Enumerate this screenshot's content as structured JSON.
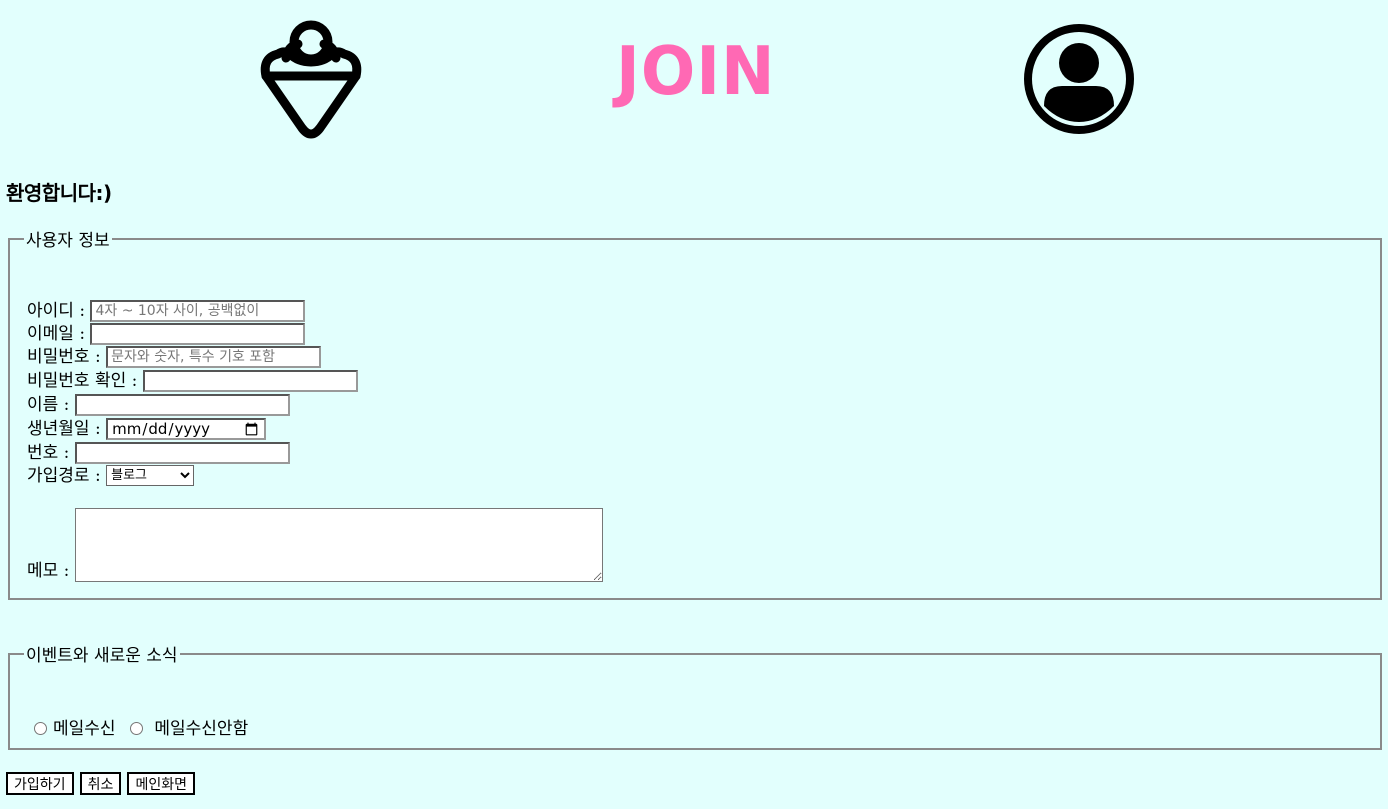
{
  "header": {
    "title": "JOIN",
    "logo_icon": "ice-cream-icon",
    "profile_icon": "user-circle-icon",
    "title_color": "#ff69b4"
  },
  "welcome": "환영합니다:)",
  "user_info": {
    "legend": "사용자 정보",
    "id_label": "아이디 :",
    "id_placeholder": "4자 ~ 10자 사이, 공백없이",
    "email_label": "이메일 :",
    "password_label": "비밀번호 :",
    "password_placeholder": "문자와 숫자, 특수 기호 포함",
    "password_confirm_label": "비밀번호 확인 :",
    "name_label": "이름 :",
    "birthday_label": "생년월일 :",
    "birthday_value": "mm/dd/yyyy",
    "phone_label": "번호 :",
    "signup_path_label": "가입경로 :",
    "signup_path_selected": "블로그",
    "memo_label": "메모 :"
  },
  "events": {
    "legend": "이벤트와 새로운 소식",
    "option_receive": "메일수신",
    "option_decline": "메일수신안함"
  },
  "buttons": {
    "submit": "가입하기",
    "cancel": "취소",
    "main": "메인화면"
  },
  "colors": {
    "background": "#e2fffd",
    "accent": "#ff69b4"
  }
}
